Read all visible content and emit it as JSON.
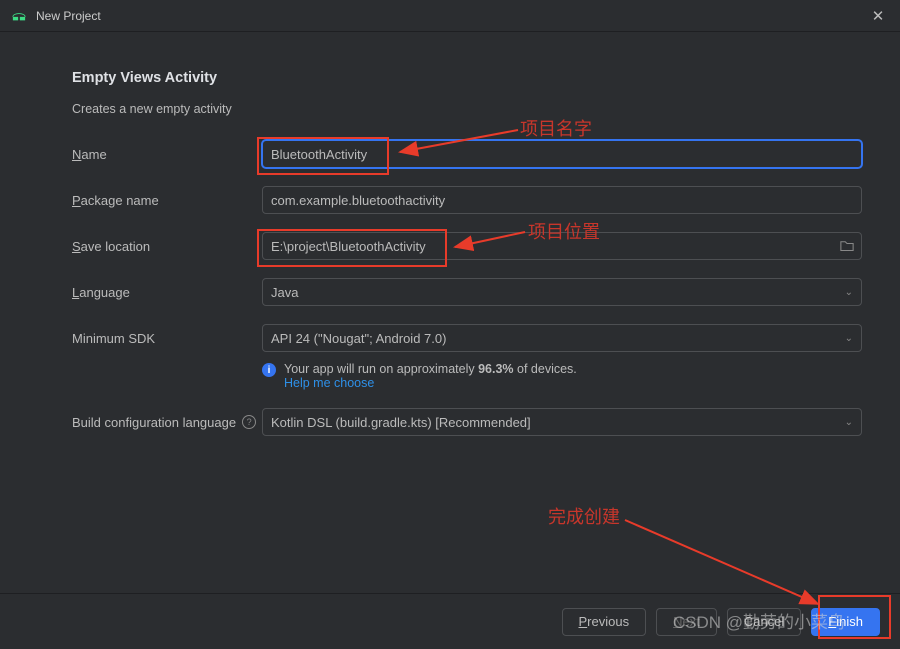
{
  "titlebar": {
    "title": "New Project"
  },
  "heading": "Empty Views Activity",
  "subtext": "Creates a new empty activity",
  "form": {
    "name": {
      "label_pre": "N",
      "label_rest": "ame",
      "value": "BluetoothActivity"
    },
    "package": {
      "label_pre": "P",
      "label_rest": "ackage name",
      "value": "com.example.bluetoothactivity"
    },
    "save": {
      "label_pre": "S",
      "label_rest": "ave location",
      "value": "E:\\project\\BluetoothActivity"
    },
    "language": {
      "label_pre": "L",
      "label_rest": "anguage",
      "value": "Java"
    },
    "minsdk": {
      "label": "Minimum SDK",
      "value": "API 24 (\"Nougat\"; Android 7.0)"
    },
    "help": {
      "text_pre": "Your app will run on approximately ",
      "percent": "96.3%",
      "text_post": " of devices.",
      "link": "Help me choose"
    },
    "buildconfig": {
      "label": "Build configuration language",
      "value": "Kotlin DSL (build.gradle.kts) [Recommended]"
    }
  },
  "footer": {
    "previous": {
      "mn": "P",
      "rest": "revious"
    },
    "next": {
      "mn": "N",
      "rest": "ext"
    },
    "cancel": "Cancel",
    "finish": {
      "mn": "F",
      "rest": "inish"
    }
  },
  "annotations": {
    "name": "项目名字",
    "location": "项目位置",
    "finish": "完成创建"
  },
  "watermark": "CSDN @勤劳的小菜鸟"
}
